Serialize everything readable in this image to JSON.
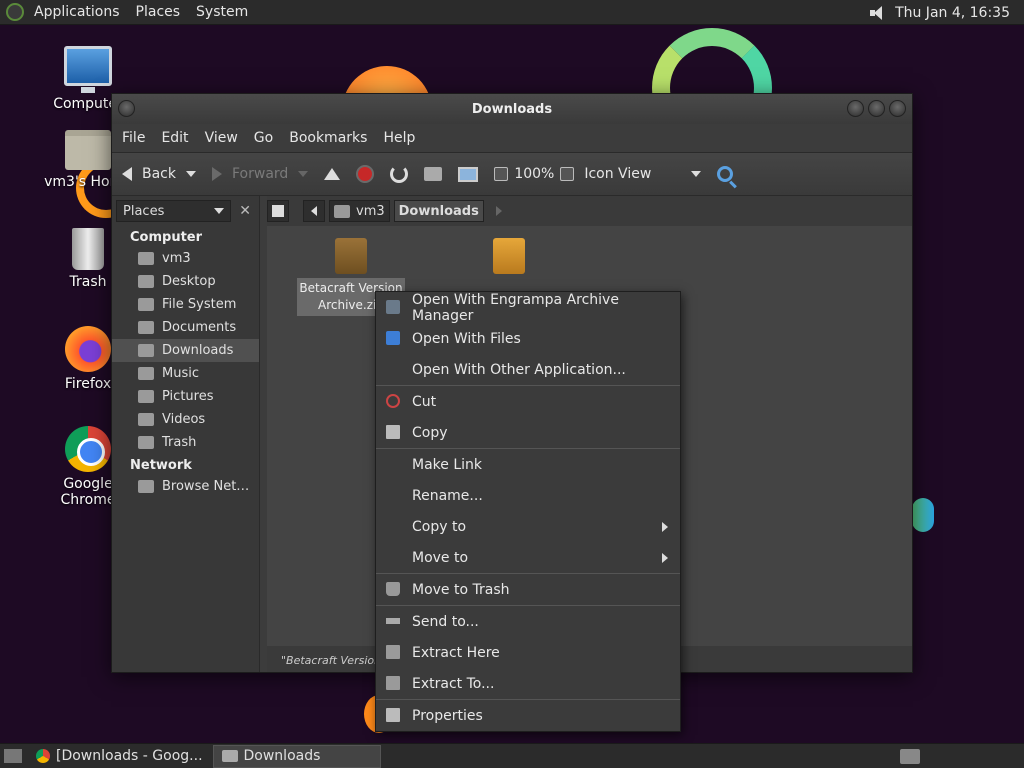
{
  "top_panel": {
    "menus": [
      "Applications",
      "Places",
      "System"
    ],
    "clock": "Thu Jan  4, 16:35"
  },
  "desktop_icons": [
    {
      "label": "Computer",
      "icon": "computer-icon"
    },
    {
      "label": "vm3's Home",
      "icon": "home-folder-icon"
    },
    {
      "label": "Trash",
      "icon": "trash-icon"
    },
    {
      "label": "Firefox",
      "icon": "firefox-icon"
    },
    {
      "label": "Google Chrome",
      "icon": "chrome-icon"
    }
  ],
  "window": {
    "title": "Downloads",
    "menu": [
      "File",
      "Edit",
      "View",
      "Go",
      "Bookmarks",
      "Help"
    ],
    "toolbar": {
      "back": "Back",
      "forward": "Forward",
      "zoom": "100%",
      "view_mode": "Icon View"
    },
    "sidebar": {
      "selector": "Places",
      "close": "✕",
      "group_computer": "Computer",
      "computer_items": [
        "vm3",
        "Desktop",
        "File System",
        "Documents",
        "Downloads",
        "Music",
        "Pictures",
        "Videos",
        "Trash"
      ],
      "group_network": "Network",
      "network_items": [
        "Browse Net…"
      ]
    },
    "pathbar": [
      "vm3",
      "Downloads"
    ],
    "files": [
      {
        "label": "Betacraft Version Archive.zip"
      }
    ],
    "status": "\"Betacraft Version A"
  },
  "context_menu": {
    "items": [
      {
        "label": "Open With Engrampa Archive Manager",
        "icon": "archive-icon"
      },
      {
        "label": "Open With Files",
        "icon": "files-icon"
      },
      {
        "label": "Open With Other Application...",
        "icon": ""
      },
      {
        "label": "Cut",
        "icon": "scissors-icon"
      },
      {
        "label": "Copy",
        "icon": "copy-icon"
      },
      {
        "label": "Make Link",
        "icon": ""
      },
      {
        "label": "Rename...",
        "icon": ""
      },
      {
        "label": "Copy to",
        "icon": ""
      },
      {
        "label": "Move to",
        "icon": ""
      },
      {
        "label": "Move to Trash",
        "icon": "trash-icon"
      },
      {
        "label": "Send to...",
        "icon": "send-icon"
      },
      {
        "label": "Extract Here",
        "icon": "extract-icon"
      },
      {
        "label": "Extract To...",
        "icon": "extract-icon"
      },
      {
        "label": "Properties",
        "icon": "properties-icon"
      }
    ]
  },
  "taskbar": {
    "tasks": [
      "[Downloads - Goog...",
      "Downloads"
    ]
  }
}
